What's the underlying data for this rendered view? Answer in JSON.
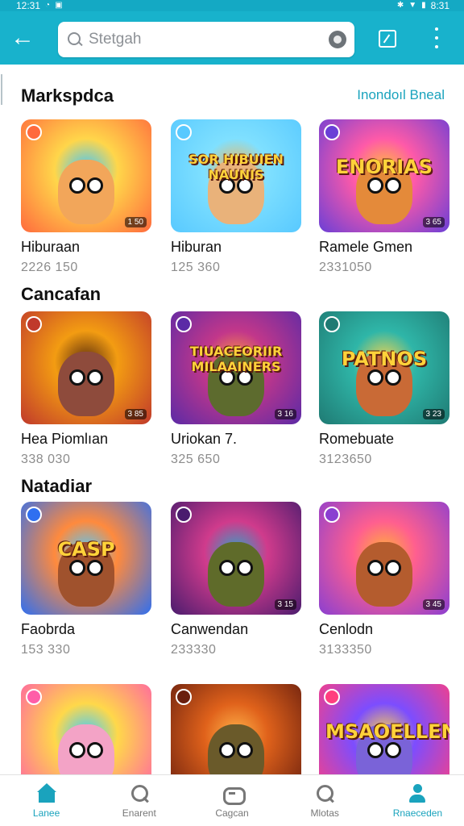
{
  "status_bar": {
    "time_left": "12:31",
    "time_right": "8:31"
  },
  "search": {
    "placeholder": "Stetgah"
  },
  "sections": [
    {
      "title": "Markspdca",
      "see_all": "Inondoıl Bneal"
    },
    {
      "title": "Cancafan"
    },
    {
      "title": "Natadiar"
    }
  ],
  "cards": [
    {
      "title": "Hiburaan",
      "meta": "2226 150",
      "art": "",
      "badge": "1 50",
      "colors": [
        "#ff6a3d",
        "#ffd64a",
        "#3ec6ff"
      ],
      "char": "#f2a65a"
    },
    {
      "title": "Hiburan",
      "meta": "125 360",
      "art": "SOR HIBUIEN NAUNIS",
      "badge": "",
      "colors": [
        "#58c9ff",
        "#7fe0ff",
        "#ffb347"
      ],
      "char": "#e9b27a"
    },
    {
      "title": "Ramele Gmen",
      "meta": "2331050",
      "art": "ENORIAS",
      "badge": "3 65",
      "colors": [
        "#6a3fd6",
        "#ff5aa8",
        "#ffbf3a"
      ],
      "char": "#e48a3a"
    },
    {
      "title": "Hea Piomlıan",
      "meta": "338 030",
      "art": "",
      "badge": "3 85",
      "colors": [
        "#c0392b",
        "#f39c12",
        "#5a2d0c"
      ],
      "char": "#8e4b3c"
    },
    {
      "title": "Uriokan 7.",
      "meta": "325 650",
      "art": "TIUACEORIIR MILAAINERS",
      "badge": "3 16",
      "colors": [
        "#5b2aa6",
        "#c2378a",
        "#ff9a3d"
      ],
      "char": "#5d6b2e"
    },
    {
      "title": "Romebuate",
      "meta": "3123650",
      "art": "PATNOS",
      "badge": "3 23",
      "colors": [
        "#1f7a73",
        "#2fb6a8",
        "#ffd54a"
      ],
      "char": "#c96a36"
    },
    {
      "title": "Faobrda",
      "meta": "153 330",
      "art": "CASP",
      "badge": "",
      "colors": [
        "#2f6ff0",
        "#ff8a3d",
        "#4ec9ff"
      ],
      "char": "#a0522d"
    },
    {
      "title": "Canwendan",
      "meta": "233330",
      "art": "",
      "badge": "3 15",
      "colors": [
        "#4a1c6e",
        "#d03b8c",
        "#2aa7c7"
      ],
      "char": "#5f6b2a"
    },
    {
      "title": "Cenlodn",
      "meta": "3133350",
      "art": "",
      "badge": "3 45",
      "colors": [
        "#8a3fd1",
        "#ff5f8f",
        "#ffb03a"
      ],
      "char": "#b45c2e"
    },
    {
      "title": "",
      "meta": "",
      "art": "",
      "badge": "",
      "colors": [
        "#ff5ea8",
        "#ffd84a",
        "#3ecbff"
      ],
      "char": "#f3a3c6"
    },
    {
      "title": "",
      "meta": "",
      "art": "",
      "badge": "",
      "colors": [
        "#6a1f0e",
        "#e0621b",
        "#ffb34a"
      ],
      "char": "#6a5a2a"
    },
    {
      "title": "",
      "meta": "",
      "art": "MSAOELLEN",
      "badge": "",
      "colors": [
        "#ff3f7f",
        "#7c4dff",
        "#ffd54a"
      ],
      "char": "#7a63d8"
    }
  ],
  "bottom_nav": [
    {
      "label": "Lanee",
      "icon": "home-icon",
      "active": true
    },
    {
      "label": "Enarent",
      "icon": "search-icon",
      "active": false
    },
    {
      "label": "Cagcan",
      "icon": "gamepad-icon",
      "active": false
    },
    {
      "label": "Mlotas",
      "icon": "search-icon",
      "active": false
    },
    {
      "label": "Rnaeceden",
      "icon": "profile-icon",
      "active": true
    }
  ],
  "colors": {
    "app_bar": "#18b2cc",
    "accent": "#1aa3bd"
  }
}
